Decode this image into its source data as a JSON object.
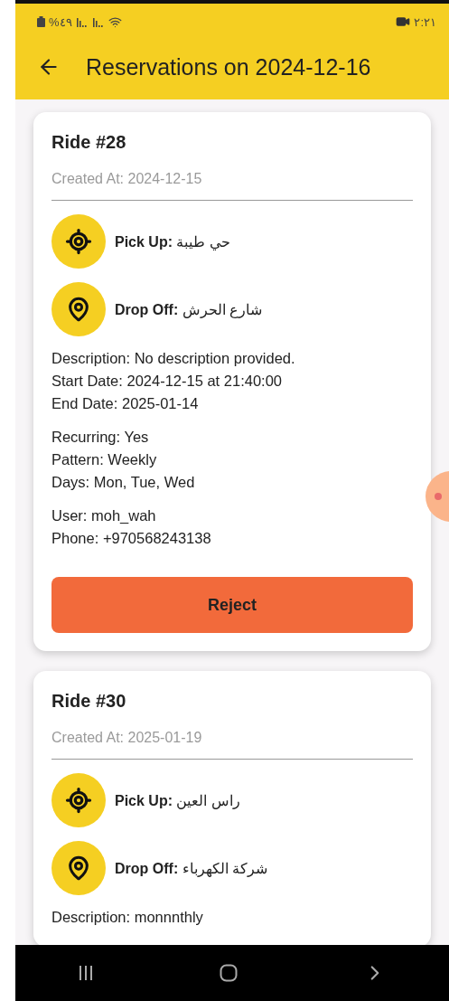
{
  "status_bar": {
    "battery": "%٤٩",
    "time": "٢:٢١"
  },
  "app_bar": {
    "title": "Reservations on 2024-12-16"
  },
  "rides": [
    {
      "title": "Ride #28",
      "created_at": "Created At: 2024-12-15",
      "pickup": {
        "label": "Pick Up:",
        "value": "حي طيبة"
      },
      "dropoff": {
        "label": "Drop Off:",
        "value": "شارع الحرش"
      },
      "groups": [
        [
          "Description: No description provided.",
          "Start Date: 2024-12-15 at 21:40:00",
          "End Date: 2025-01-14"
        ],
        [
          "Recurring: Yes",
          "Pattern: Weekly",
          "Days: Mon, Tue, Wed"
        ],
        [
          "User: moh_wah",
          "Phone: +970568243138"
        ]
      ],
      "button": "Reject"
    },
    {
      "title": "Ride #30",
      "created_at": "Created At: 2025-01-19",
      "pickup": {
        "label": "Pick Up:",
        "value": "راس العين"
      },
      "dropoff": {
        "label": "Drop Off:",
        "value": "شركة الكهرباء"
      },
      "groups": [
        [
          "Description: monnnthly"
        ]
      ]
    }
  ]
}
